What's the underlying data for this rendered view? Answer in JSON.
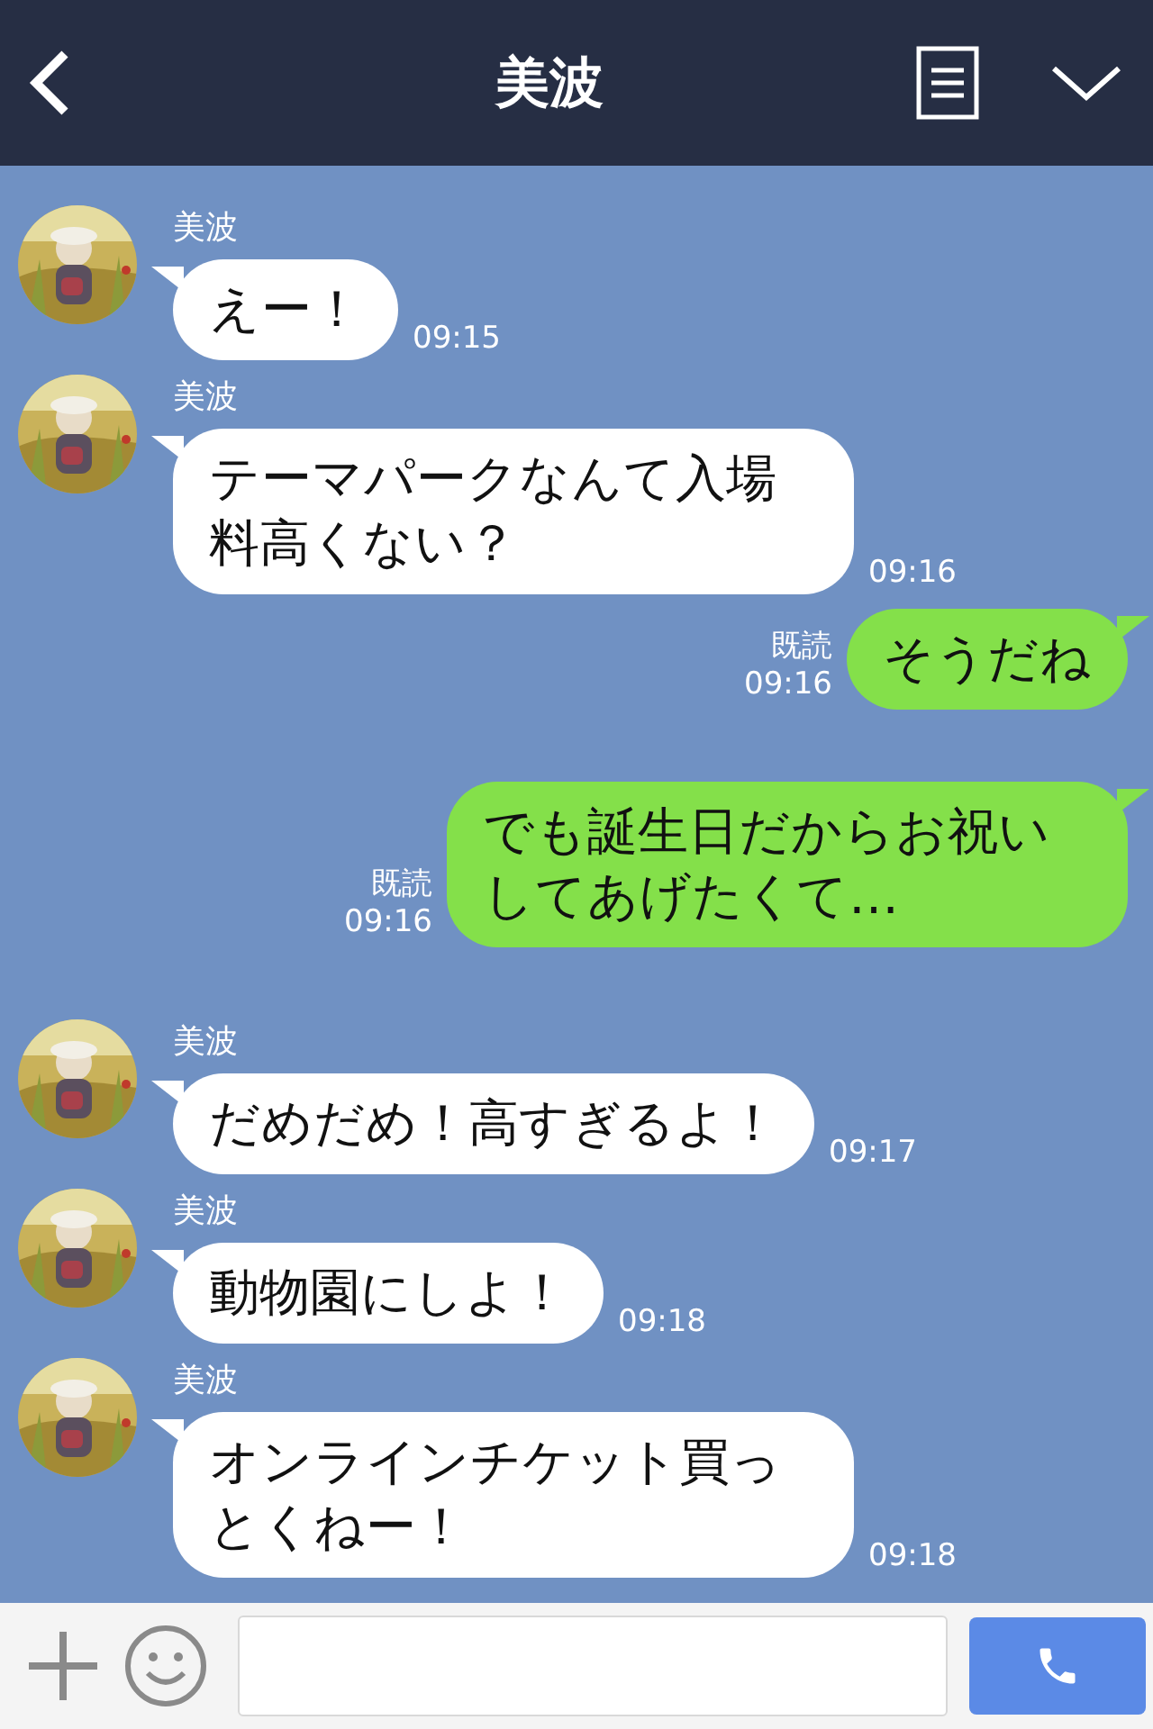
{
  "header": {
    "title": "美波"
  },
  "messages": [
    {
      "kind": "incoming",
      "sender": "美波",
      "text": "えー！",
      "time": "09:15"
    },
    {
      "kind": "incoming",
      "sender": "美波",
      "text": "テーマパークなんて入場料高くない？",
      "time": "09:16"
    },
    {
      "kind": "outgoing",
      "read": "既読",
      "text": "そうだね",
      "time": "09:16"
    },
    {
      "kind": "outgoing",
      "read": "既読",
      "text": "でも誕生日だからお祝いしてあげたくて…",
      "time": "09:16"
    },
    {
      "kind": "incoming",
      "sender": "美波",
      "text": "だめだめ！高すぎるよ！",
      "time": "09:17"
    },
    {
      "kind": "incoming",
      "sender": "美波",
      "text": "動物園にしよ！",
      "time": "09:18"
    },
    {
      "kind": "incoming",
      "sender": "美波",
      "text": "オンラインチケット買っとくねー！",
      "time": "09:18"
    }
  ]
}
